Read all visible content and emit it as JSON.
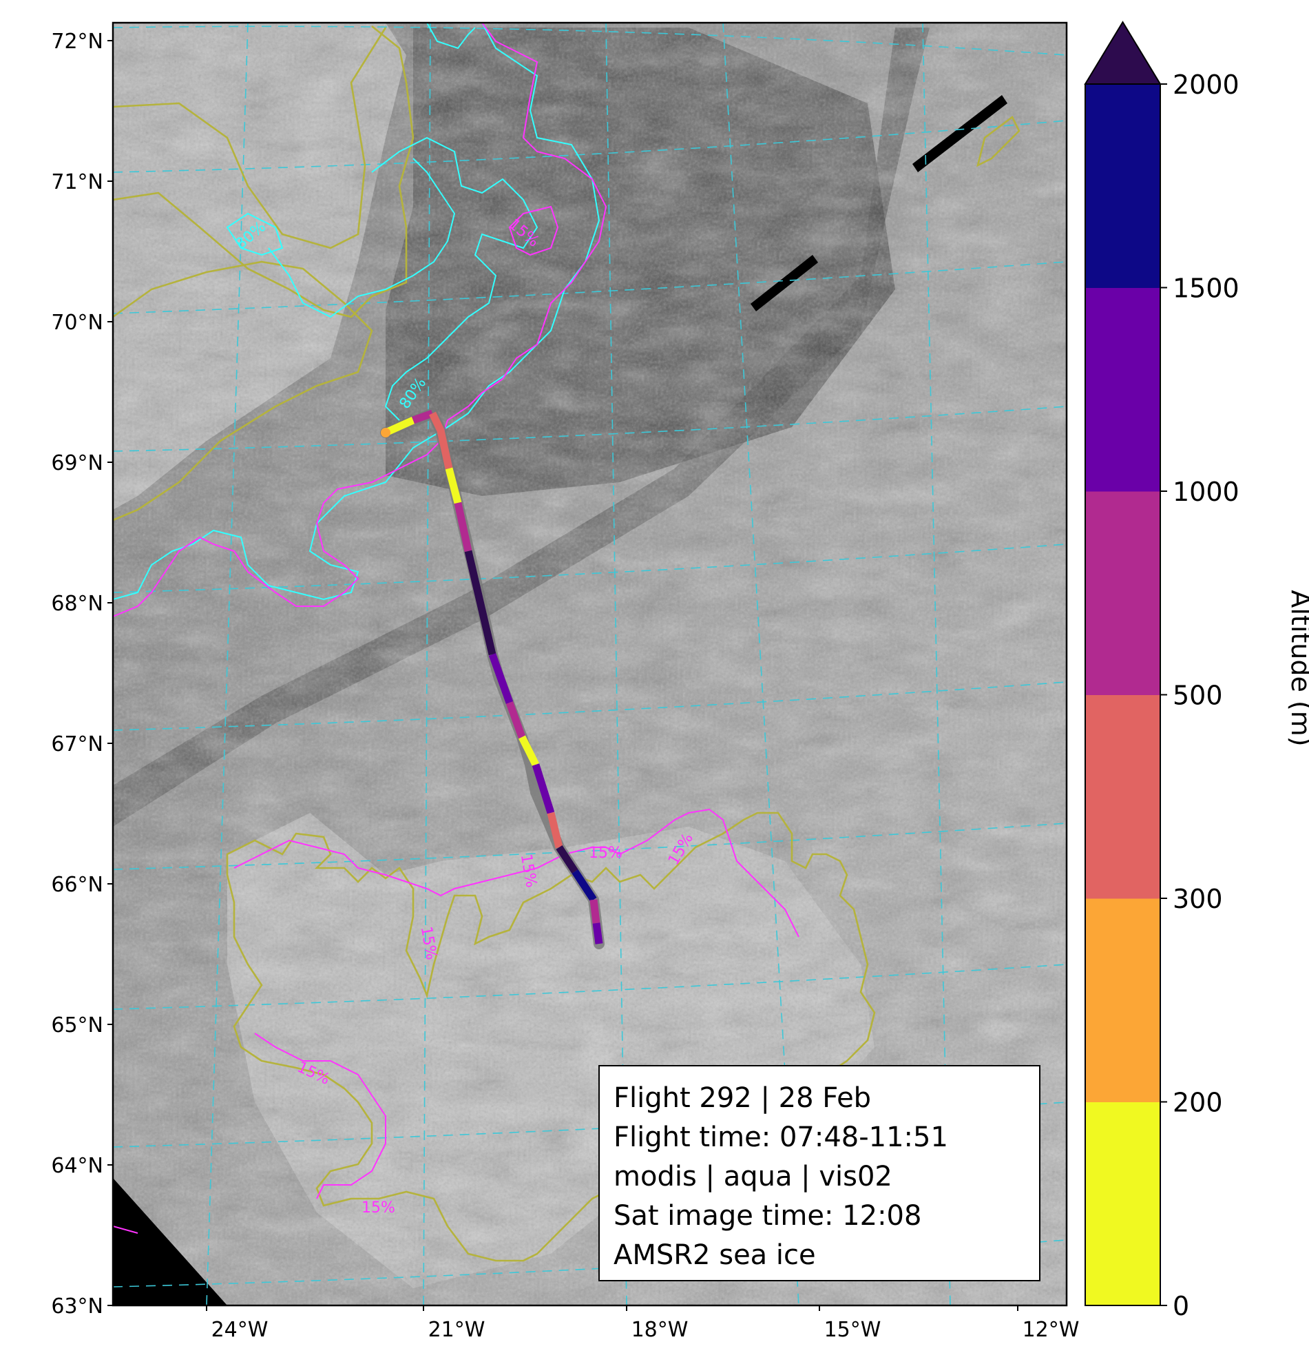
{
  "map": {
    "lat_labels": [
      "72°N",
      "71°N",
      "70°N",
      "69°N",
      "68°N",
      "67°N",
      "66°N",
      "65°N",
      "64°N",
      "63°N"
    ],
    "lon_labels": [
      "24°W",
      "21°W",
      "18°W",
      "15°W",
      "12°W"
    ],
    "contour_labels": {
      "ice80": [
        "80%",
        "80%"
      ],
      "ice15": [
        "15%",
        "15%",
        "15%",
        "15%",
        "15%",
        "15%",
        "15%"
      ]
    },
    "colors": {
      "ice15_contour": "#ff33ff",
      "ice80_contour": "#33ffff",
      "land_contour": "#b5b33c",
      "graticule": "#3cc8d8"
    }
  },
  "colorbar": {
    "label": "Altitude (m)",
    "ticks": [
      "0",
      "200",
      "300",
      "500",
      "1000",
      "1500",
      "2000"
    ],
    "bounds": [
      0,
      200,
      300,
      500,
      1000,
      1500,
      2000
    ],
    "colors": [
      "#f0f921",
      "#fca636",
      "#e16462",
      "#b12a90",
      "#6a00a8",
      "#0d0887"
    ],
    "extend_color": "#2d0b4e",
    "extend": "max"
  },
  "info": {
    "line1": "Flight 292 | 28 Feb",
    "line2": "Flight time: 07:48-11:51",
    "line3": "modis | aqua | vis02",
    "line4": "Sat image time: 12:08",
    "line5": "AMSR2 sea ice"
  }
}
